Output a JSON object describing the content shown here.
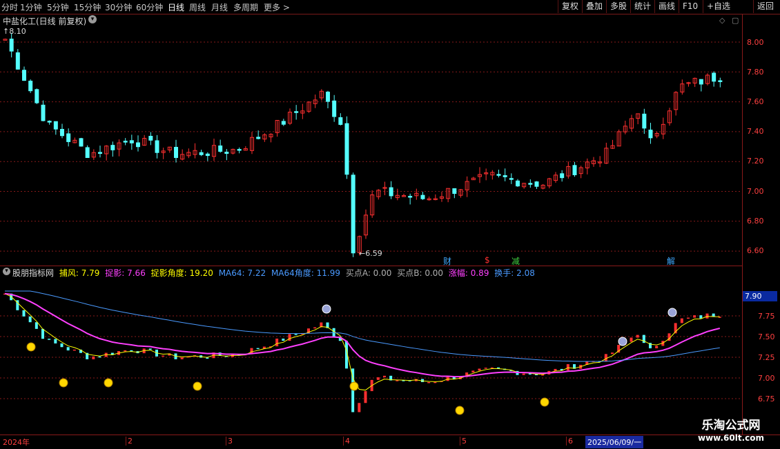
{
  "toolbar": {
    "periods": [
      "分时",
      "1分钟",
      "5分钟",
      "15分钟",
      "30分钟",
      "60分钟",
      "日线",
      "周线",
      "月线",
      "多周期",
      "更多"
    ],
    "active_period": "日线",
    "buttons": [
      "复权",
      "叠加",
      "多股",
      "统计",
      "画线",
      "F10",
      "+自选",
      "返回"
    ]
  },
  "main_panel": {
    "title": "中盐化工(日线 前复权)",
    "high_label": "8.10",
    "low_label": "6.59",
    "price_ticks": [
      "8.00",
      "7.80",
      "7.60",
      "7.40",
      "7.20",
      "7.00",
      "6.80",
      "6.60"
    ],
    "event_markers": [
      {
        "label": "财",
        "color": "#3fa9ff"
      },
      {
        "label": "$",
        "color": "#ff3030"
      },
      {
        "label": "减",
        "color": "#40d040"
      },
      {
        "label": "解",
        "color": "#3fa9ff"
      }
    ]
  },
  "indicator_panel": {
    "name": "股朋指标网",
    "values": [
      {
        "label": "捕风: 7.79",
        "color": "#ffff00"
      },
      {
        "label": "捉影: 7.66",
        "color": "#ff40ff"
      },
      {
        "label": "捉影角度: 19.20",
        "color": "#ffff00"
      },
      {
        "label": "MA64: 7.22",
        "color": "#4a9aff"
      },
      {
        "label": "MA64角度: 11.99",
        "color": "#4a9aff"
      },
      {
        "label": "买点A: 0.00",
        "color": "#b0b0b0"
      },
      {
        "label": "买点B: 0.00",
        "color": "#b0b0b0"
      },
      {
        "label": "涨幅: 0.89",
        "color": "#ff40ff"
      },
      {
        "label": "换手: 2.08",
        "color": "#4a9aff"
      }
    ],
    "price_ticks": [
      "7.75",
      "7.50",
      "7.25",
      "7.00",
      "6.75"
    ],
    "current_value": "7.90"
  },
  "time_axis": {
    "labels": [
      "2024年",
      "2",
      "3",
      "4",
      "5",
      "6"
    ],
    "cursor_date": "2025/06/09/一"
  },
  "watermark": {
    "title": "乐淘公式网",
    "url": "www.60lt.com"
  },
  "colors": {
    "up": "#ff3030",
    "down": "#54ffff",
    "grid": "#8a1a1a",
    "ma_fast": "#ffff00",
    "ma_slow": "#ff40ff",
    "ma64": "#4a9aff"
  }
}
